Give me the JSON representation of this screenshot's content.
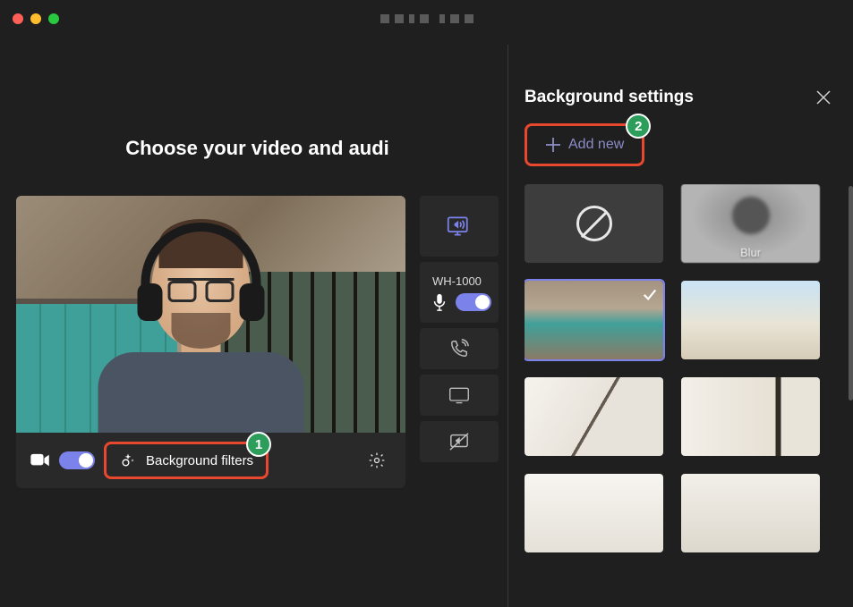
{
  "heading": "Choose your video and audi",
  "video_controls": {
    "background_filters_label": "Background filters"
  },
  "side_controls": {
    "device_name": "WH-1000"
  },
  "panel": {
    "title": "Background settings",
    "add_new_label": "Add new"
  },
  "background_options": {
    "blur_label": "Blur"
  },
  "callouts": {
    "one": "1",
    "two": "2"
  },
  "colors": {
    "accent": "#7b83eb",
    "highlight_border": "#e8482e",
    "badge": "#2d9d5c"
  }
}
